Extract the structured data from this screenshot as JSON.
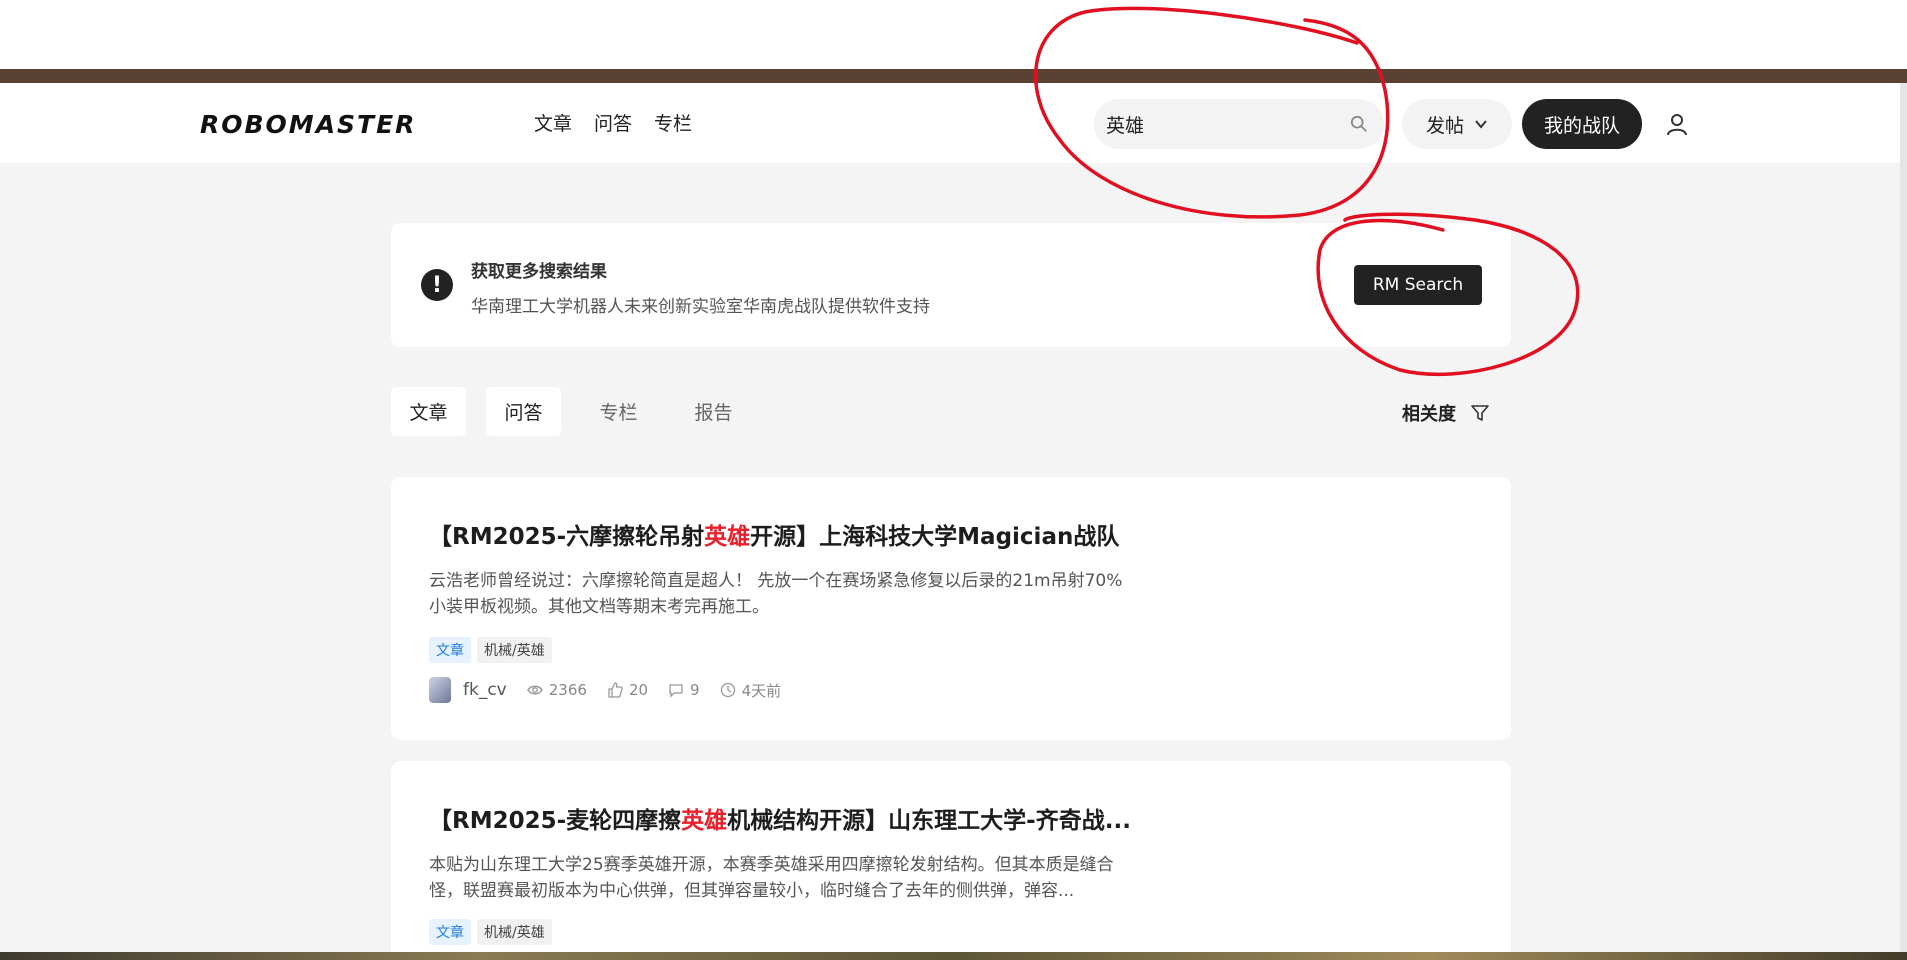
{
  "header": {
    "logo_text": "ROBOMASTER",
    "nav": [
      "文章",
      "问答",
      "专栏"
    ],
    "search_value": "英雄",
    "post_label": "发帖",
    "team_label": "我的战队"
  },
  "notice": {
    "title": "获取更多搜索结果",
    "subtitle": "华南理工大学机器人未来创新实验室华南虎战队提供软件支持",
    "button": "RM Search"
  },
  "tabs": [
    "文章",
    "问答",
    "专栏",
    "报告"
  ],
  "sort_label": "相关度",
  "results": [
    {
      "title_pre": "【RM2025-六摩擦轮吊射",
      "title_hl": "英雄",
      "title_post": "开源】上海科技大学Magician战队",
      "desc": "云浩老师曾经说过：六摩擦轮简直是超人！ 先放一个在赛场紧急修复以后录的21m吊射70%小装甲板视频。其他文档等期末考完再施工。",
      "tag_type": "文章",
      "tag_category": "机械/英雄",
      "author": "fk_cv",
      "views": "2366",
      "likes": "20",
      "comments": "9",
      "time": "4天前"
    },
    {
      "title_pre": "【RM2025-麦轮四摩擦",
      "title_hl": "英雄",
      "title_post": "机械结构开源】山东理工大学-齐奇战...",
      "desc": "本贴为山东理工大学25赛季英雄开源，本赛季英雄采用四摩擦轮发射结构。但其本质是缝合怪，联盟赛最初版本为中心供弹，但其弹容量较小，临时缝合了去年的侧供弹，弹容...",
      "tag_type": "文章",
      "tag_category": "机械/英雄"
    }
  ],
  "colors": {
    "brown_bar": "#5a4232",
    "highlight": "#e8202b",
    "annotation": "#e01020"
  }
}
